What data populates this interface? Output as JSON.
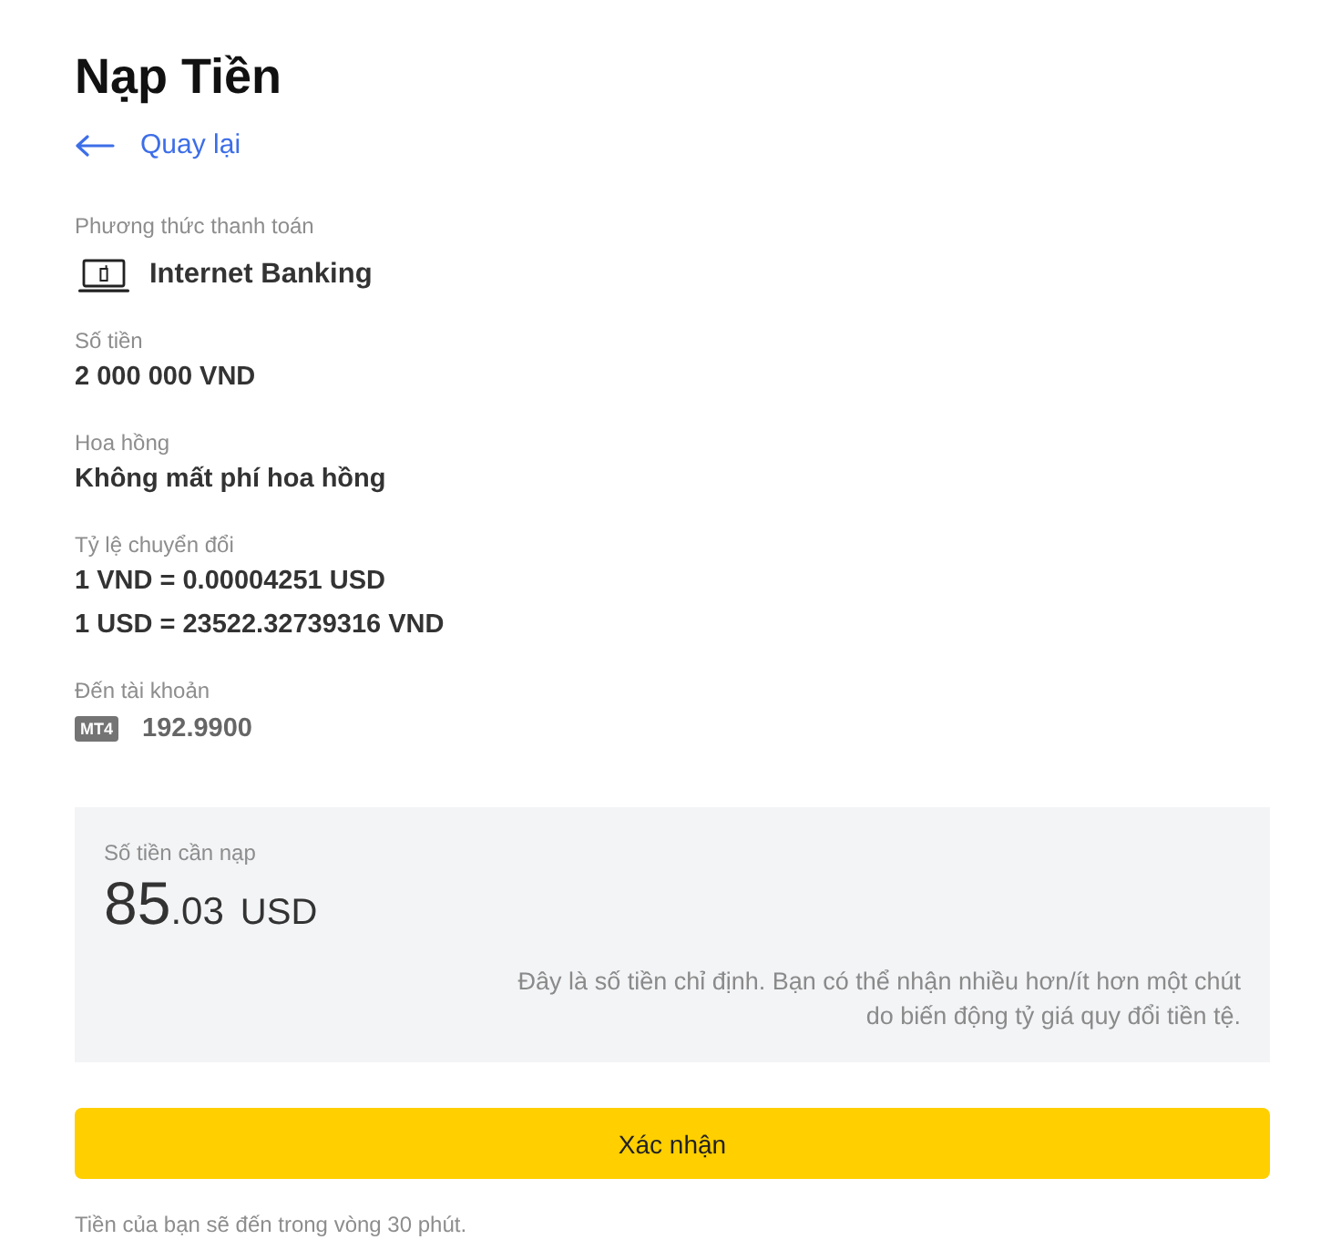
{
  "title": "Nạp Tiền",
  "back_link": {
    "label": "Quay lại"
  },
  "details": [
    {
      "kind": "method",
      "label": "Phương thức thanh toán",
      "value": "Internet Banking"
    },
    {
      "kind": "text",
      "label": "Số tiền",
      "value": "2 000 000 VND"
    },
    {
      "kind": "text",
      "label": "Hoa hồng",
      "value": "Không mất phí hoa hồng"
    },
    {
      "kind": "lines",
      "label": "Tỷ lệ chuyển đổi",
      "lines": [
        "1 VND = 0.00004251 USD",
        "1 USD = 23522.32739316 VND"
      ]
    },
    {
      "kind": "account",
      "label": "Đến tài khoản",
      "platform": "MT4",
      "number": "192.9900"
    }
  ],
  "summary": {
    "label": "Số tiền cần nạp",
    "amount": {
      "integer": "85",
      "fraction": ".03",
      "currency": "USD"
    },
    "note": "Đây là số tiền chỉ định. Bạn có thể nhận nhiều hơn/ít hơn một chút do biến động tỷ giá quy đổi tiền tệ."
  },
  "confirm_button": {
    "label": "Xác nhận"
  },
  "footer_note": "Tiền của bạn sẽ đến trong vòng 30 phút."
}
